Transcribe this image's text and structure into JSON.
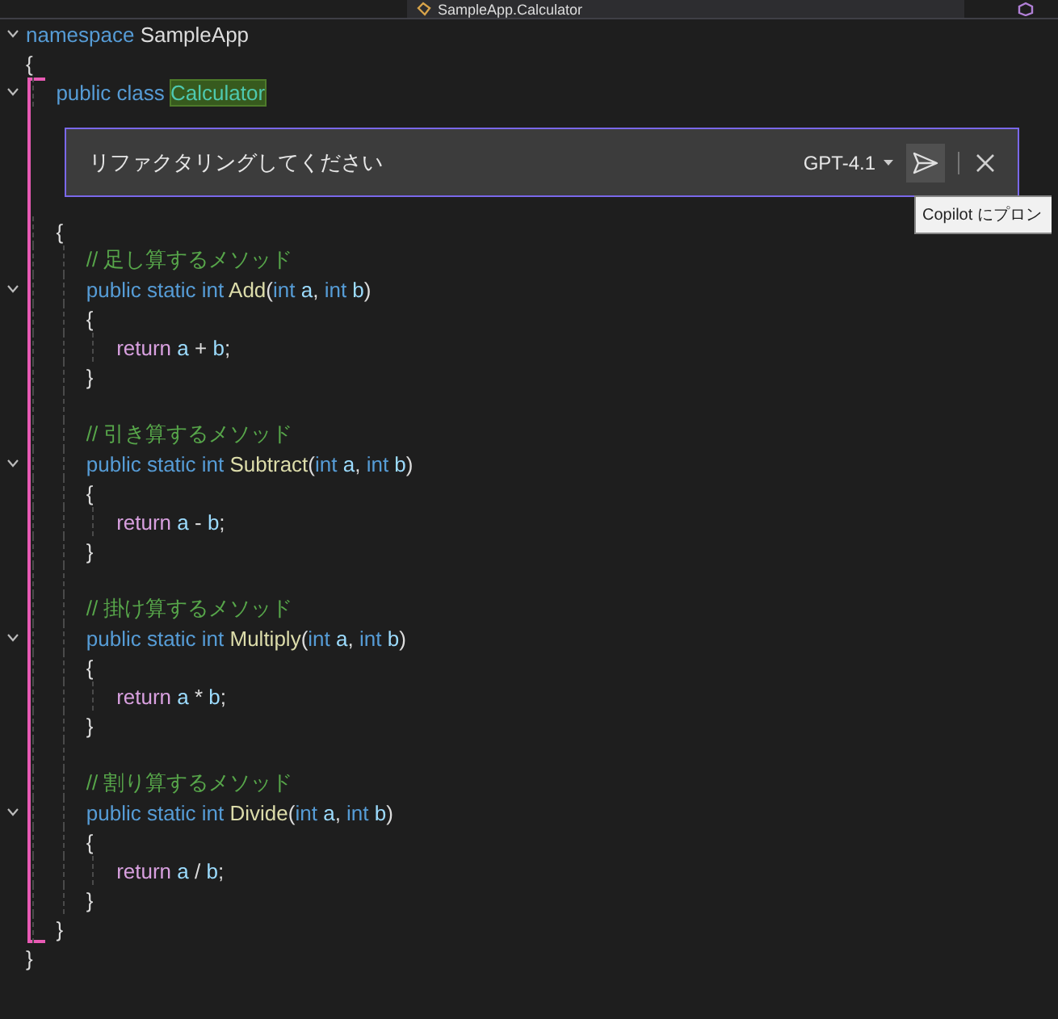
{
  "nav_bar": {
    "breadcrumb": "SampleApp.Calculator"
  },
  "code": {
    "kind": "line",
    "foldable": true,
    "tokens": [
      {
        "kind": "keyword",
        "text": "namespace"
      },
      {
        "kind": "plain",
        "text": " SampleApp"
      }
    ],
    "open": "{",
    "close": "}",
    "body": [
      {
        "kind": "line",
        "foldable": true,
        "marked": true,
        "tokens": [
          {
            "kind": "keyword",
            "text": "public"
          },
          {
            "kind": "keyword",
            "text": " class "
          },
          {
            "kind": "type",
            "text": "Calculator",
            "highlighted": true
          }
        ],
        "chat": {
          "value": "リファクタリングしてください",
          "model": "GPT-4.1",
          "tooltip": "Copilot にプロン"
        },
        "open": "{",
        "close": "}",
        "body": [
          {
            "kind": "line",
            "tokens": [
              {
                "kind": "comment",
                "text": "// 足し算するメソッド"
              }
            ]
          },
          {
            "kind": "line",
            "foldable": true,
            "tokens": [
              {
                "kind": "keyword",
                "text": "public static int"
              },
              {
                "kind": "method",
                "text": " Add"
              },
              {
                "kind": "punct",
                "text": "("
              },
              {
                "kind": "keyword",
                "text": "int"
              },
              {
                "kind": "param",
                "text": " a"
              },
              {
                "kind": "punct",
                "text": ", "
              },
              {
                "kind": "keyword",
                "text": "int"
              },
              {
                "kind": "param",
                "text": " b"
              },
              {
                "kind": "punct",
                "text": ")"
              }
            ],
            "open": "{",
            "close": "}",
            "body": [
              {
                "kind": "line",
                "tokens": [
                  {
                    "kind": "control",
                    "text": "return"
                  },
                  {
                    "kind": "param",
                    "text": " a"
                  },
                  {
                    "kind": "punct",
                    "text": " + "
                  },
                  {
                    "kind": "param",
                    "text": "b"
                  },
                  {
                    "kind": "punct",
                    "text": ";"
                  }
                ]
              }
            ]
          },
          {
            "kind": "blank"
          },
          {
            "kind": "line",
            "tokens": [
              {
                "kind": "comment",
                "text": "// 引き算するメソッド"
              }
            ]
          },
          {
            "kind": "line",
            "foldable": true,
            "tokens": [
              {
                "kind": "keyword",
                "text": "public static int"
              },
              {
                "kind": "method",
                "text": " Subtract"
              },
              {
                "kind": "punct",
                "text": "("
              },
              {
                "kind": "keyword",
                "text": "int"
              },
              {
                "kind": "param",
                "text": " a"
              },
              {
                "kind": "punct",
                "text": ", "
              },
              {
                "kind": "keyword",
                "text": "int"
              },
              {
                "kind": "param",
                "text": " b"
              },
              {
                "kind": "punct",
                "text": ")"
              }
            ],
            "open": "{",
            "close": "}",
            "body": [
              {
                "kind": "line",
                "tokens": [
                  {
                    "kind": "control",
                    "text": "return"
                  },
                  {
                    "kind": "param",
                    "text": " a"
                  },
                  {
                    "kind": "punct",
                    "text": " - "
                  },
                  {
                    "kind": "param",
                    "text": "b"
                  },
                  {
                    "kind": "punct",
                    "text": ";"
                  }
                ]
              }
            ]
          },
          {
            "kind": "blank"
          },
          {
            "kind": "line",
            "tokens": [
              {
                "kind": "comment",
                "text": "// 掛け算するメソッド"
              }
            ]
          },
          {
            "kind": "line",
            "foldable": true,
            "tokens": [
              {
                "kind": "keyword",
                "text": "public static int"
              },
              {
                "kind": "method",
                "text": " Multiply"
              },
              {
                "kind": "punct",
                "text": "("
              },
              {
                "kind": "keyword",
                "text": "int"
              },
              {
                "kind": "param",
                "text": " a"
              },
              {
                "kind": "punct",
                "text": ", "
              },
              {
                "kind": "keyword",
                "text": "int"
              },
              {
                "kind": "param",
                "text": " b"
              },
              {
                "kind": "punct",
                "text": ")"
              }
            ],
            "open": "{",
            "close": "}",
            "body": [
              {
                "kind": "line",
                "tokens": [
                  {
                    "kind": "control",
                    "text": "return"
                  },
                  {
                    "kind": "param",
                    "text": " a"
                  },
                  {
                    "kind": "punct",
                    "text": " * "
                  },
                  {
                    "kind": "param",
                    "text": "b"
                  },
                  {
                    "kind": "punct",
                    "text": ";"
                  }
                ]
              }
            ]
          },
          {
            "kind": "blank"
          },
          {
            "kind": "line",
            "tokens": [
              {
                "kind": "comment",
                "text": "// 割り算するメソッド"
              }
            ]
          },
          {
            "kind": "line",
            "foldable": true,
            "tokens": [
              {
                "kind": "keyword",
                "text": "public static int"
              },
              {
                "kind": "method",
                "text": " Divide"
              },
              {
                "kind": "punct",
                "text": "("
              },
              {
                "kind": "keyword",
                "text": "int"
              },
              {
                "kind": "param",
                "text": " a"
              },
              {
                "kind": "punct",
                "text": ", "
              },
              {
                "kind": "keyword",
                "text": "int"
              },
              {
                "kind": "param",
                "text": " b"
              },
              {
                "kind": "punct",
                "text": ")"
              }
            ],
            "open": "{",
            "close": "}",
            "body": [
              {
                "kind": "line",
                "tokens": [
                  {
                    "kind": "control",
                    "text": "return"
                  },
                  {
                    "kind": "param",
                    "text": " a"
                  },
                  {
                    "kind": "punct",
                    "text": " / "
                  },
                  {
                    "kind": "param",
                    "text": "b"
                  },
                  {
                    "kind": "punct",
                    "text": ";"
                  }
                ]
              }
            ]
          }
        ]
      }
    ]
  }
}
